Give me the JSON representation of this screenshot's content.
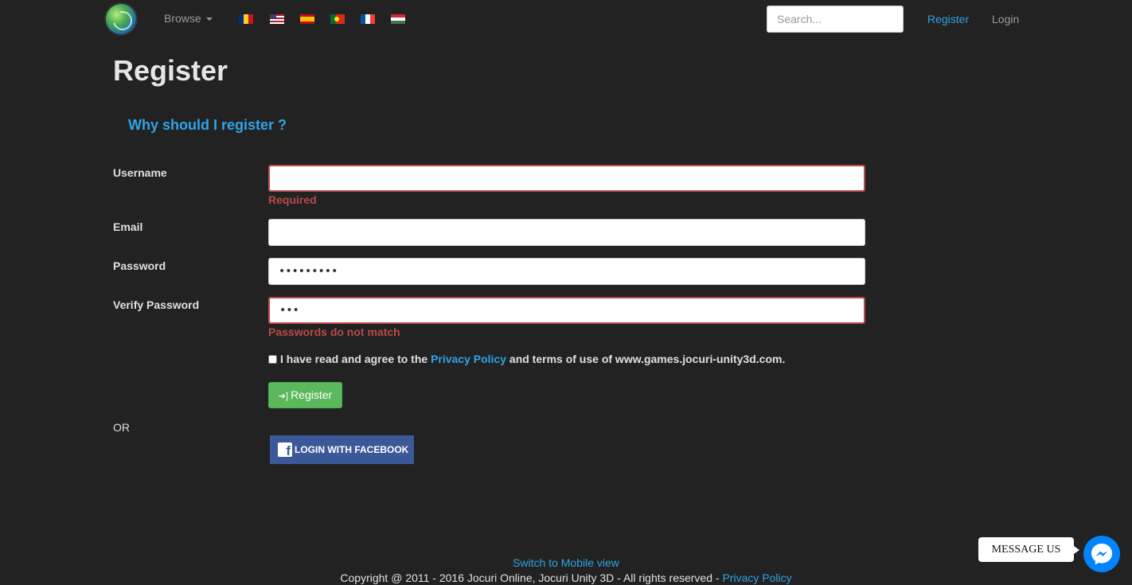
{
  "nav": {
    "browse_label": "Browse",
    "flags": [
      "flag-romania-icon",
      "flag-usa-icon",
      "flag-spain-icon",
      "flag-portugal-icon",
      "flag-france-icon",
      "flag-hungary-icon"
    ],
    "search_placeholder": "Search...",
    "register_label": "Register",
    "login_label": "Login"
  },
  "page": {
    "title": "Register",
    "why_link": "Why should I register ?"
  },
  "form": {
    "username": {
      "label": "Username",
      "value": "",
      "error": "Required"
    },
    "email": {
      "label": "Email",
      "value": ""
    },
    "password": {
      "label": "Password",
      "value": "•••••••••"
    },
    "verify": {
      "label": "Verify Password",
      "value": "•••",
      "error": "Passwords do not match"
    },
    "agree_prefix": "I have read and agree to the",
    "agree_link": "Privacy Policy",
    "agree_suffix": "and terms of use of www.games.jocuri-unity3d.com.",
    "register_button": "Register",
    "or_label": "OR",
    "facebook_button": "LOGIN WITH FACEBOOK"
  },
  "footer": {
    "mobile_link": "Switch to Mobile view",
    "copyright": "Copyright @ 2011 - 2016 Jocuri Online, Jocuri Unity 3D - All rights reserved -",
    "privacy_link": "Privacy Policy"
  },
  "messenger": {
    "label": "MESSAGE US"
  },
  "colors": {
    "background": "#222222",
    "link": "#2fa4e7",
    "error": "#b94a48",
    "success": "#5cb85c",
    "facebook": "#3b5998",
    "messenger": "#0084ff"
  }
}
